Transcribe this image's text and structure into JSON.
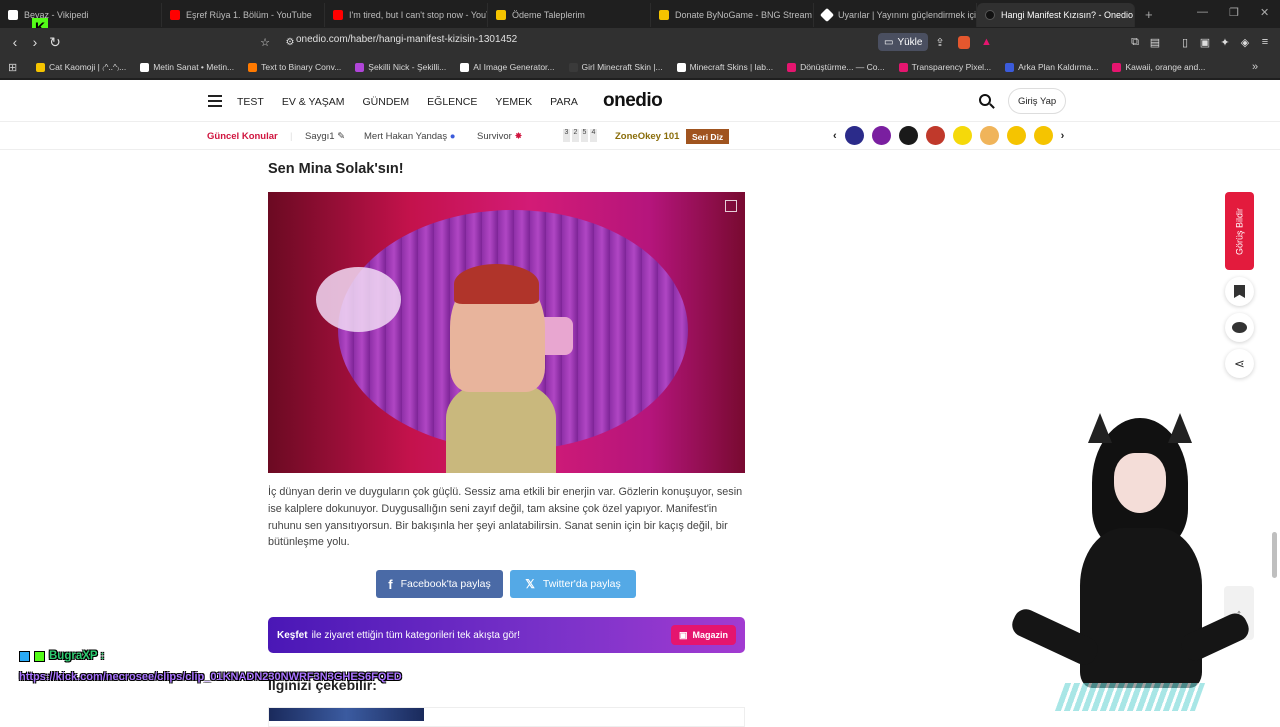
{
  "browser": {
    "tabs": [
      {
        "title": "Beyaz - Vikipedi",
        "color": "#ffffff"
      },
      {
        "title": "Eşref Rüya 1. Bölüm - YouTube",
        "color": "#ff0000"
      },
      {
        "title": "I'm tired, but I can't stop now - YouT",
        "color": "#ff0000"
      },
      {
        "title": "Ödeme Taleplerim",
        "color": "#f5c400"
      },
      {
        "title": "Donate ByNoGame - BNG Stream De",
        "color": "#f5c400"
      },
      {
        "title": "Uyarılar | Yayınını güçlendirmek için",
        "color": "#ffffff"
      },
      {
        "title": "Hangi Manifest Kızısın? - Onedio",
        "color": "#111111"
      }
    ],
    "new_tab": "+",
    "url": "onedio.com/haber/hangi-manifest-kizisin-1301452",
    "load_label": "Yükle",
    "bookmarks": [
      {
        "label": "Cat Kaomoji | ₍^..^₎...",
        "color": "#f5c400"
      },
      {
        "label": "Metin Sanat • Metin...",
        "color": "#ffffff"
      },
      {
        "label": "Text to Binary Conv...",
        "color": "#ff7a00"
      },
      {
        "label": "Şekilli Nick - Şekilli...",
        "color": "#b045d8"
      },
      {
        "label": "AI Image Generator...",
        "color": "#ffffff"
      },
      {
        "label": "Girl Minecraft Skin |...",
        "color": "#3a3a3a"
      },
      {
        "label": "Minecraft Skins | lab...",
        "color": "#ffffff"
      },
      {
        "label": "Dönüştürme... — Co...",
        "color": "#e5156f"
      },
      {
        "label": "Transparency Pixel...",
        "color": "#e5156f"
      },
      {
        "label": "Arka Plan Kaldırma...",
        "color": "#3b5bdb"
      },
      {
        "label": "Kawaii, orange and...",
        "color": "#e5156f"
      }
    ]
  },
  "site": {
    "logo": "onedio",
    "nav": [
      "TEST",
      "EV & YAŞAM",
      "GÜNDEM",
      "EĞLENCE",
      "YEMEK",
      "PARA"
    ],
    "login": "Giriş Yap",
    "current_topics": "Güncel Konular",
    "topics": [
      "Saygı1",
      "Mert Hakan Yandaş",
      "Survivor"
    ],
    "zone_numbers": [
      "3",
      "2",
      "5",
      "4"
    ],
    "zone_label": "ZoneOkey 101",
    "seri_label": "Seri Diz",
    "emoji_colors": [
      "#2b2b8a",
      "#7a1fa0",
      "#1a1a1a",
      "#c0392b",
      "#f5d90a",
      "#f0b45a",
      "#f5c400",
      "#f5c400"
    ]
  },
  "article": {
    "title": "Sen Mina Solak'sın!",
    "description": "İç dünyan derin ve duyguların çok güçlü. Sessiz ama etkili bir enerjin var. Gözlerin konuşuyor, sesin ise kalplere dokunuyor. Duygusallığın seni zayıf değil, tam aksine çok özel yapıyor. Manifest'in ruhunu sen yansıtıyorsun. Bir bakışınla her şeyi anlatabilirsin. Sanat senin için bir kaçış değil, bir bütünleşme yolu.",
    "facebook_share": "Facebook'ta paylaş",
    "twitter_share": "Twitter'da paylaş",
    "banner_bold": "Keşfet",
    "banner_text": "ile ziyaret ettiğin tüm kategorileri tek akışta gör!",
    "banner_button": "Magazin",
    "related_title": "İlginizi çekebilir:"
  },
  "sidebar": {
    "feedback": "Görüş Bildir"
  },
  "overlay": {
    "chat_user": "BugraXP :",
    "chat_message": "https://kick.com/necrosee/clips/clip_01KNADN230NWRF3N3GHES6FQED",
    "kick_letter": "K"
  }
}
